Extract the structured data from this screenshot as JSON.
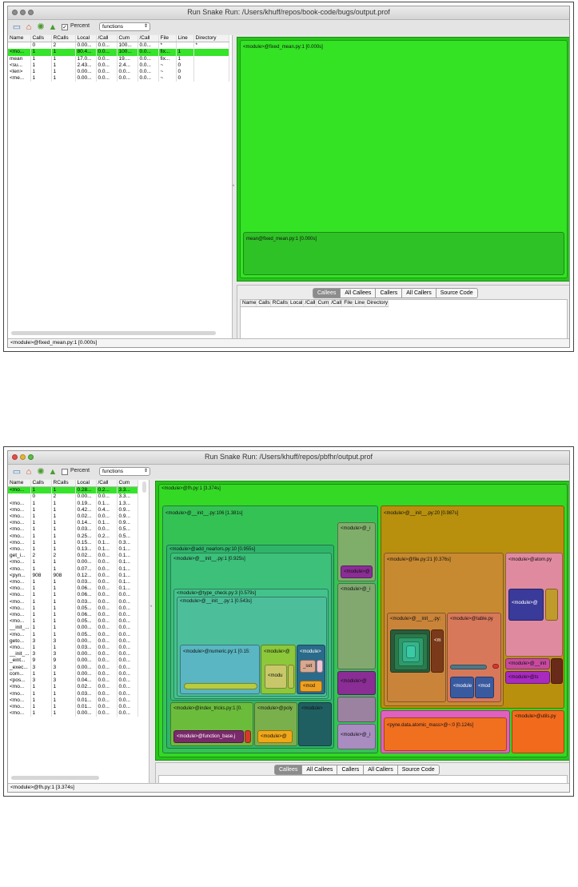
{
  "window1": {
    "title": "Run Snake Run: /Users/khuff/repos/book-code/bugs/output.prof",
    "percent_label": "Percent",
    "percent_checked": true,
    "view_mode": "functions",
    "columns": [
      "Name",
      "Calls",
      "RCalls",
      "Local",
      "/Call",
      "Cum",
      "/Call",
      "File",
      "Line",
      "Directory"
    ],
    "rows": [
      [
        "",
        "0",
        "2",
        "0.00...",
        "0.0...",
        "100...",
        "0.0...",
        "*",
        "",
        "*"
      ],
      [
        "<mo...",
        "1",
        "1",
        "80.4...",
        "0.0...",
        "100...",
        "0.0...",
        "fix...",
        "1",
        ""
      ],
      [
        "mean",
        "1",
        "1",
        "17.0...",
        "0.0...",
        "19....",
        "0.0...",
        "fix...",
        "1",
        ""
      ],
      [
        "<su...",
        "1",
        "1",
        "2.43...",
        "0.0...",
        "2.4...",
        "0.0...",
        "~",
        "0",
        ""
      ],
      [
        "<len>",
        "1",
        "1",
        "0.00...",
        "0.0...",
        "0.0...",
        "0.0...",
        "~",
        "0",
        ""
      ],
      [
        "<me...",
        "1",
        "1",
        "0.00...",
        "0.0...",
        "0.0...",
        "0.0...",
        "~",
        "0",
        ""
      ]
    ],
    "selected_row": 1,
    "map_root_label": "<module>@fixed_mean.py:1 [0.000s]",
    "map_child_label": "mean@fixed_mean.py:1 [0.000s]",
    "tabs": [
      "Callees",
      "All Callees",
      "Callers",
      "All Callers",
      "Source Code"
    ],
    "active_tab": 0,
    "bottom_columns": [
      "Name",
      "Calls",
      "RCalls",
      "Local",
      "/Call",
      "Cum",
      "/Call",
      "File",
      "Line",
      "Directory"
    ],
    "status": "<module>@fixed_mean.py:1 [0.000s]"
  },
  "window2": {
    "title": "Run Snake Run: /Users/khuff/repos/pbfhr/output.prof",
    "percent_label": "Percent",
    "percent_checked": false,
    "view_mode": "functions",
    "columns": [
      "Name",
      "Calls",
      "RCalls",
      "Local",
      "/Call",
      "Cum"
    ],
    "rows": [
      [
        "<mo...",
        "1",
        "1",
        "0.28...",
        "0.2...",
        "3.3..."
      ],
      [
        "",
        "0",
        "2",
        "0.00...",
        "0.0...",
        "3.3..."
      ],
      [
        "<mo...",
        "1",
        "1",
        "0.19...",
        "0.1...",
        "1.3..."
      ],
      [
        "<mo...",
        "1",
        "1",
        "0.42...",
        "0.4...",
        "0.9..."
      ],
      [
        "<mo...",
        "1",
        "1",
        "0.02...",
        "0.0...",
        "0.9..."
      ],
      [
        "<mo...",
        "1",
        "1",
        "0.14...",
        "0.1...",
        "0.9..."
      ],
      [
        "<mo...",
        "1",
        "1",
        "0.03...",
        "0.0...",
        "0.5..."
      ],
      [
        "<mo...",
        "1",
        "1",
        "0.25...",
        "0.2...",
        "0.5..."
      ],
      [
        "<mo...",
        "1",
        "1",
        "0.15...",
        "0.1...",
        "0.3..."
      ],
      [
        "<mo...",
        "1",
        "1",
        "0.13...",
        "0.1...",
        "0.1..."
      ],
      [
        "get_i...",
        "2",
        "2",
        "0.02...",
        "0.0...",
        "0.1..."
      ],
      [
        "<mo...",
        "1",
        "1",
        "0.00...",
        "0.0...",
        "0.1..."
      ],
      [
        "<mo...",
        "1",
        "1",
        "0.07...",
        "0.0...",
        "0.1..."
      ],
      [
        "<pyn...",
        "908",
        "908",
        "0.12...",
        "0.0...",
        "0.1..."
      ],
      [
        "<mo...",
        "1",
        "1",
        "0.03...",
        "0.0...",
        "0.1..."
      ],
      [
        "<mo...",
        "1",
        "1",
        "0.06...",
        "0.0...",
        "0.1..."
      ],
      [
        "<mo...",
        "1",
        "1",
        "0.06...",
        "0.0...",
        "0.0..."
      ],
      [
        "<mo...",
        "1",
        "1",
        "0.03...",
        "0.0...",
        "0.0..."
      ],
      [
        "<mo...",
        "1",
        "1",
        "0.05...",
        "0.0...",
        "0.0..."
      ],
      [
        "<mo...",
        "1",
        "1",
        "0.06...",
        "0.0...",
        "0.0..."
      ],
      [
        "<mo...",
        "1",
        "1",
        "0.05...",
        "0.0...",
        "0.0..."
      ],
      [
        "__init_...",
        "1",
        "1",
        "0.00...",
        "0.0...",
        "0.0..."
      ],
      [
        "<mo...",
        "1",
        "1",
        "0.05...",
        "0.0...",
        "0.0..."
      ],
      [
        "geto...",
        "3",
        "3",
        "0.00...",
        "0.0...",
        "0.0..."
      ],
      [
        "<mo...",
        "1",
        "1",
        "0.03...",
        "0.0...",
        "0.0..."
      ],
      [
        "__init_...",
        "3",
        "3",
        "0.00...",
        "0.0...",
        "0.0..."
      ],
      [
        "_eint...",
        "9",
        "9",
        "0.00...",
        "0.0...",
        "0.0..."
      ],
      [
        "_exec...",
        "3",
        "3",
        "0.00...",
        "0.0...",
        "0.0..."
      ],
      [
        "com...",
        "1",
        "1",
        "0.00...",
        "0.0...",
        "0.0..."
      ],
      [
        "<pos...",
        "3",
        "3",
        "0.04...",
        "0.0...",
        "0.0..."
      ],
      [
        "<mo...",
        "1",
        "1",
        "0.02...",
        "0.0...",
        "0.0..."
      ],
      [
        "<mo...",
        "1",
        "1",
        "0.03...",
        "0.0...",
        "0.0..."
      ],
      [
        "<mo...",
        "1",
        "1",
        "0.01...",
        "0.0...",
        "0.0..."
      ],
      [
        "<mo...",
        "1",
        "1",
        "0.01...",
        "0.0...",
        "0.0..."
      ],
      [
        "<mo...",
        "1",
        "1",
        "0.00...",
        "0.0...",
        "0.0..."
      ]
    ],
    "selected_row": 0,
    "map_labels": {
      "root": "<module>@fh.py:1 [3.374s]",
      "init106": "<module>@__init__.py:106 [1.381s]",
      "init20": "<module>@__init__.py:20 [0.987s]",
      "add_nearlors": "<module>@add_nearlors.py:10 [0.955s]",
      "init1a": "<module>@__init__.py:1 [0.925s]",
      "type_check": "<module>@type_check.py:3 [0.579s]",
      "init1b": "<module>@__init__.py:1 [0.543s]",
      "numeric": "<module>@numeric.py:1 [0.15:",
      "mod_a": "<module>@",
      "mod_b": "<module>",
      "set": "_set",
      "modu": "<modu",
      "mod_c": "<mod",
      "index_tricks": "<module>@index_tricks.py:1 [0.",
      "poly": "<module>@poly",
      "mod_d": "<module>",
      "function_base": "<module>@function_base.j",
      "mod_e": "<module>@",
      "side1": "<module>@_i",
      "side1b": "<module>@",
      "side2": "<module>@_i",
      "side3": "<module>@",
      "side4": "<module>@_i",
      "file": "<module>@file.py:21 [0.376s]",
      "init_inner": "<module>@__init__.py:",
      "m_small": "<m",
      "table": "<module>@table.py",
      "modul": "<module",
      "mod_f": "<mod",
      "atom": "<module>@atom.py",
      "mod_g": "<module>@",
      "mod_init": "<module>@__init",
      "mod_ts": "<module>@ts",
      "pyne": "<pyne.data.atomic_mass>@~:0 [0.124s]",
      "utils": "<module>@utils.py"
    },
    "tabs": [
      "Callees",
      "All Callees",
      "Callers",
      "All Callers",
      "Source Code"
    ],
    "active_tab": 0,
    "status": "<module>@fh.py:1 [3.374s]"
  },
  "colors": {
    "selection": "#36e42a",
    "map_green": "#26c51a",
    "mustard": "#b8900e",
    "teal": "#3aa77a",
    "purple": "#8a2d95",
    "pink": "#e0699a",
    "orange": "#f26a1c"
  }
}
